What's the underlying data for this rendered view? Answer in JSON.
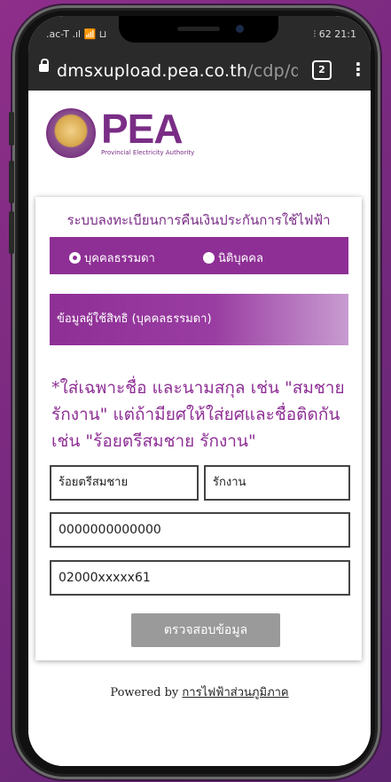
{
  "status_bar": {
    "left": ".ac-T .ıl 📶 ⊔",
    "right": "⫶ 62 21:1"
  },
  "browser": {
    "url_host": "dmsxupload.pea.co.th",
    "url_path": "/cdp/defau",
    "tab_count": "2",
    "menu_icon": "⋮"
  },
  "logo": {
    "brand": "PEA",
    "tagline": "Provincial Electricity Authority"
  },
  "form": {
    "title": "ระบบลงทะเบียนการคืนเงินประกันการใช้ไฟฟ้า",
    "radio_person": "บุคคลธรรมดา",
    "radio_juristic": "นิติบุคคล",
    "selected": "person",
    "section_title": "ข้อมูลผู้ใช้สิทธิ (บุคคลธรรมดา)",
    "note": "*ใส่เฉพาะชื่อ และนามสกุล เช่น \"สมชาย รักงาน\" แต่ถ้ามียศให้ใส่ยศและชื่อติดกัน เช่น \"ร้อยตรีสมชาย รักงาน\"",
    "first_name": "ร้อยตรีสมชาย",
    "last_name": "รักงาน",
    "id_number": "0000000000000",
    "account_number": "02000xxxxx61",
    "submit_label": "ตรวจสอบข้อมูล"
  },
  "footer": {
    "powered_by": "Powered by",
    "link_text": "การไฟฟ้าส่วนภูมิภาค"
  },
  "colors": {
    "brand": "#8e2f95",
    "background": "#7a2a80"
  }
}
